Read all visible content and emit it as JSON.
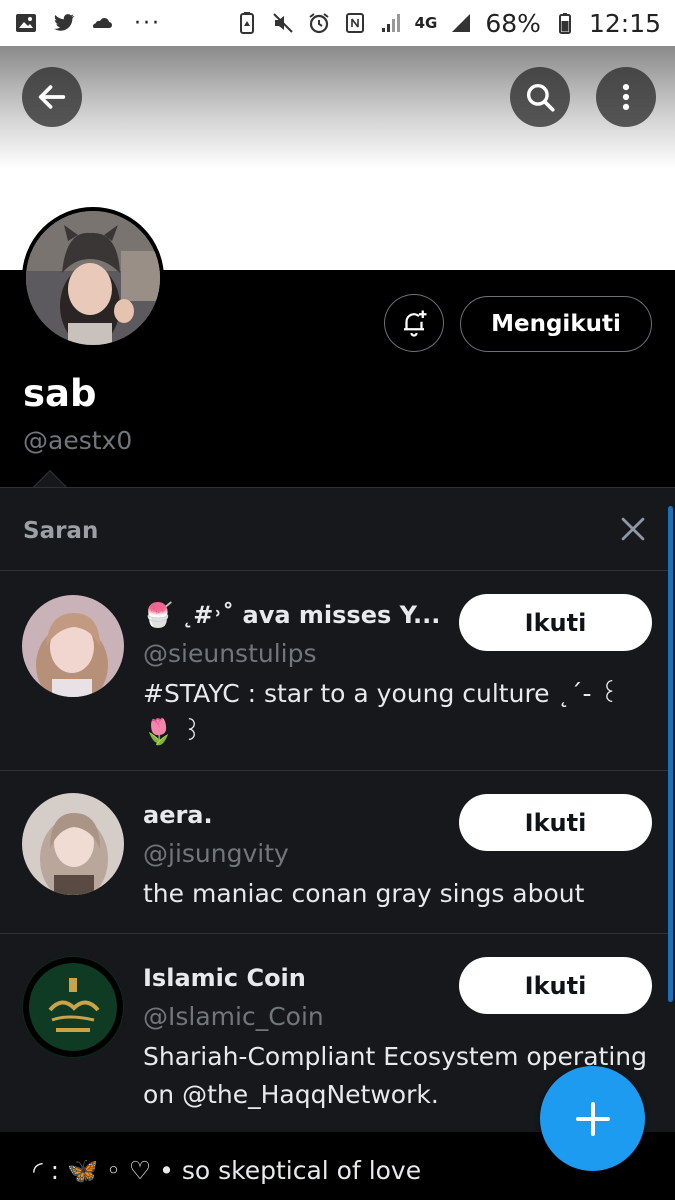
{
  "status_bar": {
    "dots": "···",
    "network": "4G",
    "battery": "68%",
    "time": "12:15"
  },
  "profile": {
    "name": "sab",
    "handle": "@aestx0",
    "following_label": "Mengikuti"
  },
  "suggestions": {
    "title": "Saran",
    "items": [
      {
        "name": "🍧 ˛#˒˚ ava misses Y...",
        "handle": "@sieunstulips",
        "bio": "#STAYC : star to a young culture ˛´- ꒰ 🌷 ꒱",
        "follow_label": "Ikuti"
      },
      {
        "name": "aera.",
        "handle": "@jisungvity",
        "bio": "the maniac conan gray sings about",
        "follow_label": "Ikuti"
      },
      {
        "name": "Islamic Coin",
        "handle": "@Islamic_Coin",
        "bio": "Shariah-Compliant Ecosystem operating on @the_HaqqNetwork.",
        "follow_label": "Ikuti"
      }
    ]
  },
  "bottom": {
    "text": "◜ : 🦋 ◦ ♡  •  so skeptical of love"
  },
  "colors": {
    "accent": "#1d9bf0",
    "panel": "#16181c",
    "muted": "#71767b"
  }
}
